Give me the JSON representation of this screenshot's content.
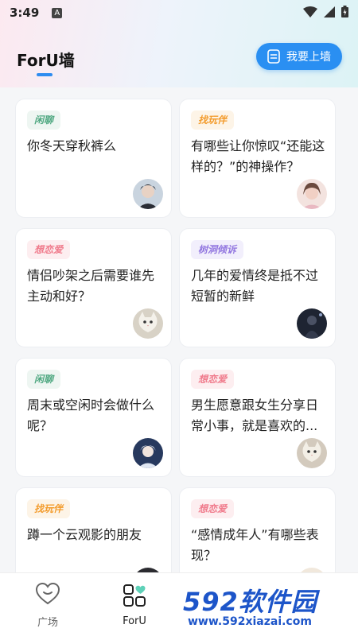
{
  "status_bar": {
    "time": "3:49",
    "notification_letter": "A"
  },
  "header": {
    "title": "ForU墙",
    "wall_button_label": "我要上墙"
  },
  "cards": [
    {
      "tag": "闲聊",
      "tag_kind": "chat",
      "text": "你冬天穿秋裤么",
      "avatar": "dark-haired-boy-avatar"
    },
    {
      "tag": "找玩伴",
      "tag_kind": "play",
      "text": "有哪些让你惊叹“还能这样的？”的神操作？",
      "avatar": "girl-avatar"
    },
    {
      "tag": "想恋爱",
      "tag_kind": "love",
      "text": "情侣吵架之后需要谁先主动和好？",
      "avatar": "cat-avatar"
    },
    {
      "tag": "树洞倾诉",
      "tag_kind": "tree",
      "text": "几年的爱情终是抵不过短暂的新鲜",
      "avatar": "night-figure-avatar"
    },
    {
      "tag": "闲聊",
      "tag_kind": "chat",
      "text": "周末或空闲时会做什么呢？",
      "avatar": "white-haired-anime-avatar"
    },
    {
      "tag": "想恋爱",
      "tag_kind": "love",
      "text": "男生愿意跟女生分享日常小事，就是喜欢的...",
      "avatar": "cat-avatar"
    },
    {
      "tag": "找玩伴",
      "tag_kind": "play",
      "text": "蹲一个云观影的朋友",
      "avatar": "dark-avatar"
    },
    {
      "tag": "想恋爱",
      "tag_kind": "love",
      "text": "“感情成年人”有哪些表现？",
      "avatar": "gamepad-avatar"
    }
  ],
  "tabbar": {
    "tabs": [
      {
        "label": "广场",
        "icon": "heart-outline-icon"
      },
      {
        "label": "ForU",
        "icon": "grid-heart-icon"
      }
    ],
    "active": "ForU"
  },
  "watermark": {
    "logo_number": "592",
    "logo_text": "软件园",
    "url": "www.592xiazai.com"
  },
  "colors": {
    "accent": "#2a8ff2",
    "tag_chat": "#4fa881",
    "tag_play": "#f39b2b",
    "tag_love": "#f07b8c",
    "tag_tree": "#9378e0",
    "watermark_blue": "#1d55c9"
  }
}
